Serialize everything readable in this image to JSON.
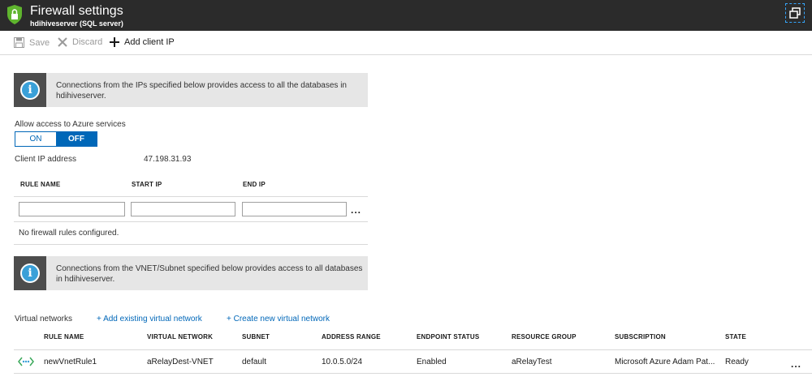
{
  "window": {
    "title": "Firewall settings",
    "subtitle": "hdihiveserver (SQL server)"
  },
  "toolbar": {
    "save_label": "Save",
    "discard_label": "Discard",
    "add_client_ip_label": "Add client IP"
  },
  "info1": {
    "text": "Connections from the IPs specified below provides access to all the databases in hdihiveserver."
  },
  "azure_services": {
    "label": "Allow access to Azure services",
    "on_label": "ON",
    "off_label": "OFF",
    "selected": "OFF"
  },
  "client_ip": {
    "label": "Client IP address",
    "value": "47.198.31.93"
  },
  "firewall_rules": {
    "columns": [
      "RULE NAME",
      "START IP",
      "END IP"
    ],
    "inputs": {
      "rule_name": "",
      "start_ip": "",
      "end_ip": ""
    },
    "more_label": "...",
    "empty_text": "No firewall rules configured."
  },
  "info2": {
    "text": "Connections from the VNET/Subnet specified below provides access to all databases in hdihiveserver."
  },
  "vnet": {
    "label": "Virtual networks",
    "add_existing_link": "+ Add existing virtual network",
    "create_new_link": "+ Create new virtual network",
    "columns": [
      "RULE NAME",
      "VIRTUAL NETWORK",
      "SUBNET",
      "ADDRESS RANGE",
      "ENDPOINT STATUS",
      "RESOURCE GROUP",
      "SUBSCRIPTION",
      "STATE"
    ],
    "rows": [
      {
        "rule_name": "newVnetRule1",
        "virtual_network": "aRelayDest-VNET",
        "subnet": "default",
        "address_range": "10.0.5.0/24",
        "endpoint_status": "Enabled",
        "resource_group": "aRelayTest",
        "subscription": "Microsoft Azure Adam Pat...",
        "state": "Ready",
        "more_label": "..."
      }
    ]
  },
  "colors": {
    "titlebar": "#2b2b2b",
    "accent": "#0067b8",
    "info_bg": "#e6e6e6",
    "shield": "#5fb52e"
  },
  "icons": [
    "shield-icon",
    "restore-window-icon",
    "save-icon",
    "discard-icon",
    "add-icon",
    "info-icon",
    "vnet-icon",
    "more-icon"
  ]
}
